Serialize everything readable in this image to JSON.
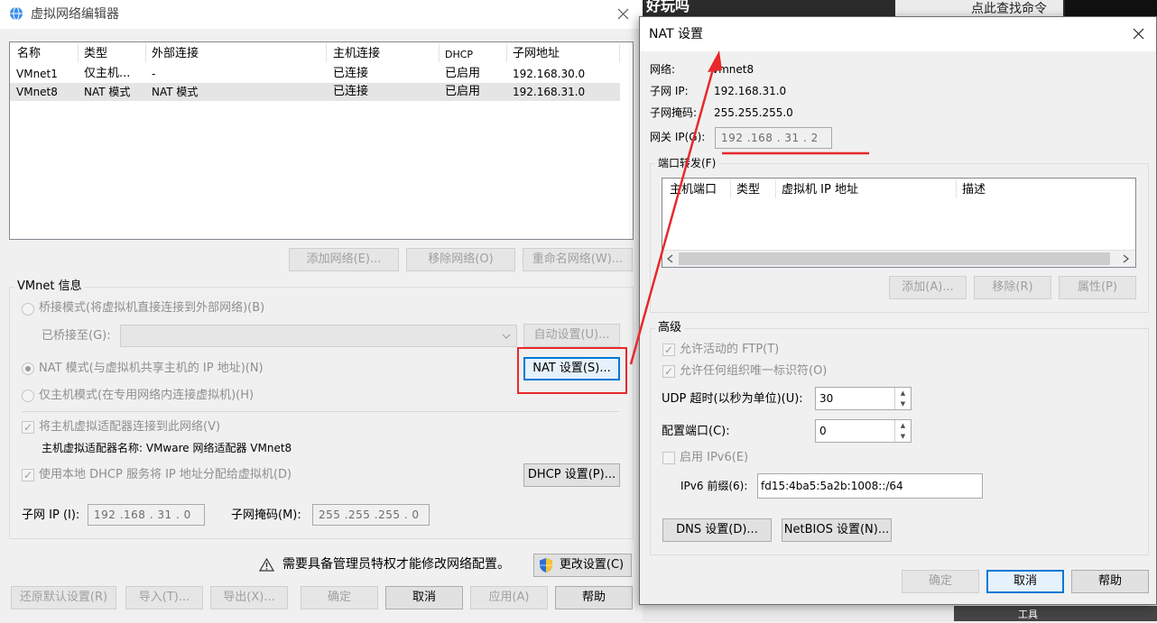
{
  "background_app": {
    "toolbar_text": "好玩吗",
    "search_placeholder": "点此查找命令",
    "bottom_text": "工具"
  },
  "main": {
    "title": "虚拟网络编辑器",
    "table": {
      "headers": [
        "名称",
        "类型",
        "外部连接",
        "主机连接",
        "DHCP",
        "子网地址"
      ],
      "rows": [
        [
          "VMnet1",
          "仅主机...",
          "-",
          "已连接",
          "已启用",
          "192.168.30.0"
        ],
        [
          "VMnet8",
          "NAT 模式",
          "NAT 模式",
          "已连接",
          "已启用",
          "192.168.31.0"
        ]
      ]
    },
    "buttons": {
      "add_network": "添加网络(E)...",
      "remove_network": "移除网络(O)",
      "rename_network": "重命名网络(W)...",
      "auto_settings": "自动设置(U)...",
      "nat_settings": "NAT 设置(S)...",
      "dhcp_settings": "DHCP 设置(P)...",
      "change_settings": "更改设置(C)",
      "restore_defaults": "还原默认设置(R)",
      "import": "导入(T)...",
      "export": "导出(X)...",
      "ok": "确定",
      "cancel": "取消",
      "apply": "应用(A)",
      "help": "帮助"
    },
    "vmnet_info": {
      "group_label": "VMnet 信息",
      "bridged_mode": "桥接模式(将虚拟机直接连接到外部网络)(B)",
      "bridged_to_label": "已桥接至(G):",
      "nat_mode": "NAT 模式(与虚拟机共享主机的 IP 地址)(N)",
      "host_only_mode": "仅主机模式(在专用网络内连接虚拟机)(H)",
      "connect_adapter": "将主机虚拟适配器连接到此网络(V)",
      "adapter_name": "主机虚拟适配器名称: VMware 网络适配器 VMnet8",
      "use_dhcp": "使用本地 DHCP 服务将 IP 地址分配给虚拟机(D)",
      "subnet_ip_label": "子网 IP (I):",
      "subnet_ip_value": "192 .168 . 31 . 0",
      "subnet_mask_label": "子网掩码(M):",
      "subnet_mask_value": "255 .255 .255 . 0"
    },
    "admin_notice": "需要具备管理员特权才能修改网络配置。"
  },
  "nat_dialog": {
    "title": "NAT 设置",
    "network_label": "网络:",
    "network_value": "vmnet8",
    "subnet_ip_label": "子网 IP:",
    "subnet_ip_value": "192.168.31.0",
    "subnet_mask_label": "子网掩码:",
    "subnet_mask_value": "255.255.255.0",
    "gateway_label": "网关 IP(G):",
    "gateway_value": "192 .168 . 31 . 2",
    "port_forward": {
      "group_label": "端口转发(F)",
      "headers": [
        "主机端口",
        "类型",
        "虚拟机 IP 地址",
        "描述"
      ],
      "add": "添加(A)...",
      "remove": "移除(R)",
      "properties": "属性(P)"
    },
    "advanced": {
      "group_label": "高级",
      "allow_ftp": "允许活动的 FTP(T)",
      "allow_any_oui": "允许任何组织唯一标识符(O)",
      "udp_timeout_label": "UDP 超时(以秒为单位)(U):",
      "udp_timeout_value": "30",
      "config_port_label": "配置端口(C):",
      "config_port_value": "0",
      "enable_ipv6": "启用 IPv6(E)",
      "ipv6_prefix_label": "IPv6 前缀(6):",
      "ipv6_prefix_value": "fd15:4ba5:5a2b:1008::/64",
      "dns_settings": "DNS 设置(D)...",
      "netbios_settings": "NetBIOS 设置(N)..."
    },
    "buttons": {
      "ok": "确定",
      "cancel": "取消",
      "help": "帮助"
    }
  },
  "annotation_color": "#e8282b"
}
